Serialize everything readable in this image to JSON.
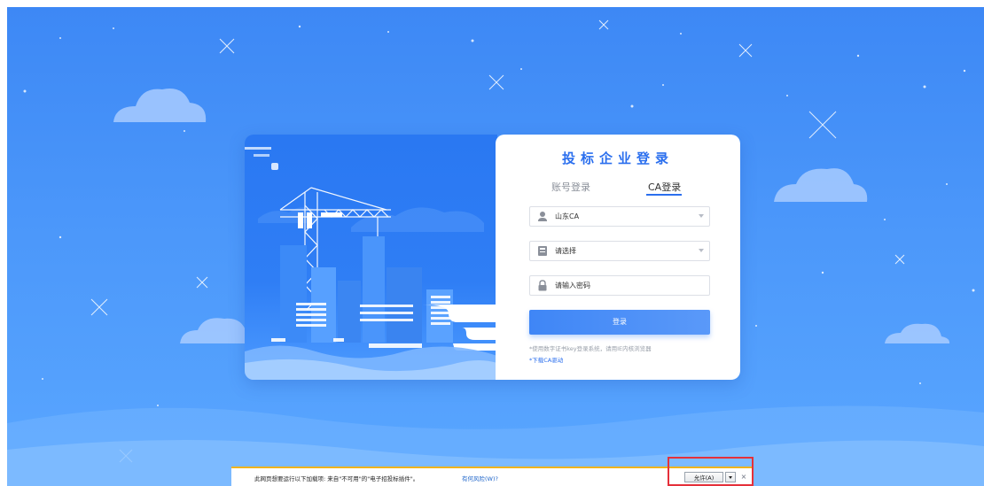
{
  "login": {
    "title": "投标企业登录",
    "tabs": {
      "account": "账号登录",
      "ca": "CA登录"
    },
    "ca_provider_value": "山东CA",
    "certificate_placeholder": "请选择",
    "password_placeholder": "请输入密码",
    "login_button": "登录",
    "hint": "*使用数字证书key登录系统，请用IE内核浏览器",
    "download_link": "*下载CA驱动"
  },
  "ie_bar": {
    "message": "此网页想要运行以下加载项: 来自\"不可用\"的\"电子招投标插件\"。",
    "risk_link": "有何风险(W)?",
    "allow_button": "允许(A)",
    "close": "×"
  },
  "colors": {
    "accent": "#2b6fee",
    "background": "#4b97fa",
    "highlight": "#e5303a",
    "ie_bar_border": "#f0b31a"
  }
}
